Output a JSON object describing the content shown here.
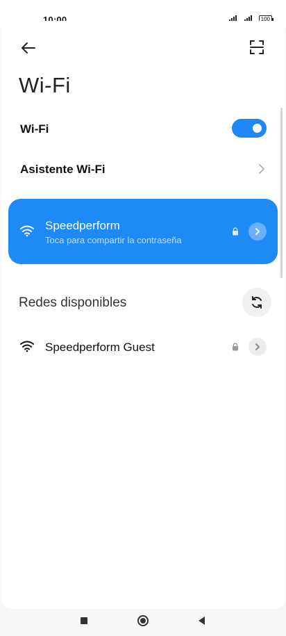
{
  "status_bar": {
    "time": "10:00",
    "battery": "100",
    "icons": [
      "signal-icon",
      "signal-icon",
      "battery-icon"
    ]
  },
  "header": {
    "back_icon": "arrow-left-icon",
    "scan_icon": "qr-scan-icon",
    "title": "Wi-Fi"
  },
  "settings": {
    "wifi_toggle": {
      "label": "Wi-Fi",
      "on": true
    },
    "assistant": {
      "label": "Asistente Wi-Fi",
      "icon": "chevron-right-icon"
    }
  },
  "connected_network": {
    "name": "Speedperform",
    "subtitle": "Toca para compartir la contraseña",
    "secured": true,
    "icon": "wifi-icon"
  },
  "available": {
    "section_label": "Redes disponibles",
    "refresh_icon": "refresh-icon",
    "networks": [
      {
        "name": "Speedperform Guest",
        "secured": true,
        "icon": "wifi-icon"
      }
    ]
  },
  "navigation_bar": {
    "icons": [
      "recents-icon",
      "home-icon",
      "back-icon"
    ]
  },
  "colors": {
    "accent": "#1e88f5",
    "card": "#1e8af5",
    "background": "#ffffff"
  }
}
